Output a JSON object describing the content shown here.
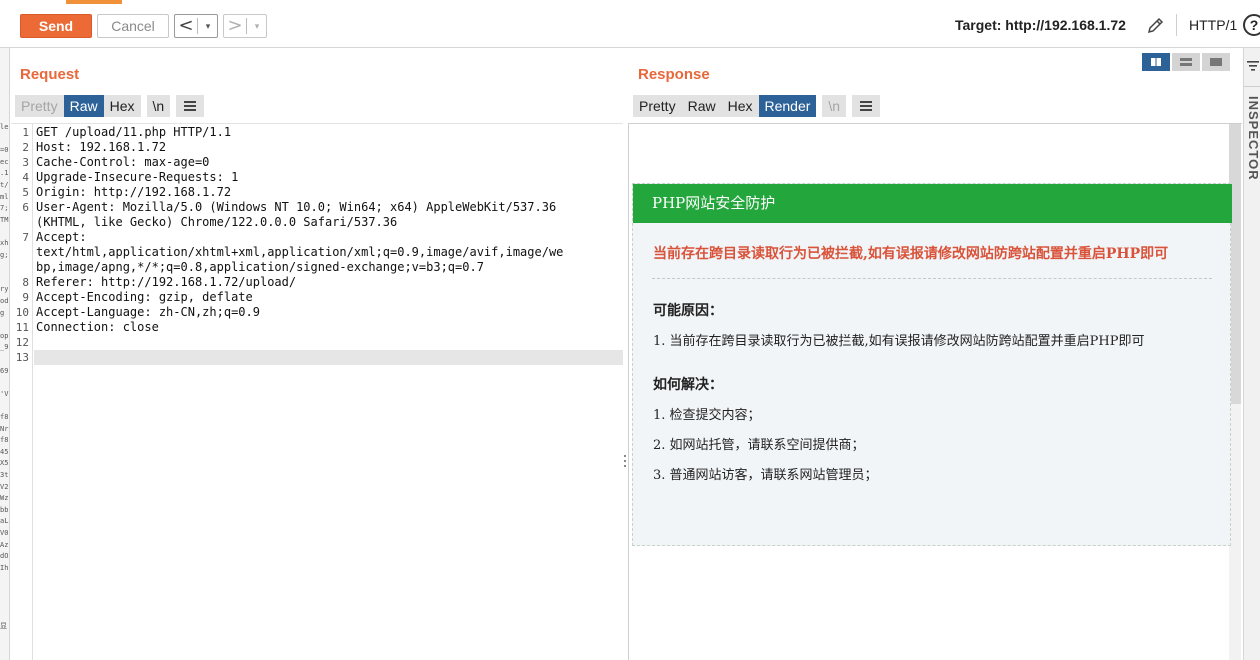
{
  "toolbar": {
    "send_label": "Send",
    "cancel_label": "Cancel",
    "back_label": "<",
    "forward_label": ">",
    "dropdown_glyph": "▾",
    "target_label": "Target: http://192.168.1.72",
    "http_version": "HTTP/1",
    "help_label": "?"
  },
  "left_strip": {
    "lines": [
      "le",
      "",
      "=0",
      "ec",
      ".1",
      "t/",
      "ml",
      "7;",
      "TM",
      "",
      "xh",
      "g;",
      "",
      "",
      "ry",
      "od",
      "g",
      "",
      "op",
      "_9",
      "",
      "69",
      "",
      "'V",
      "",
      "f8",
      "Nr",
      "f8",
      "45",
      "X5",
      "3t",
      "V2",
      "Wz",
      "bb",
      "aL",
      "V0",
      "Az",
      "dO",
      "Ih",
      "",
      "",
      "",
      "",
      "显"
    ]
  },
  "request": {
    "title": "Request",
    "tabs": [
      {
        "label": "Pretty",
        "state": "disabled"
      },
      {
        "label": "Raw",
        "state": "active"
      },
      {
        "label": "Hex",
        "state": "normal"
      },
      {
        "label": "\\n",
        "state": "normal"
      }
    ],
    "lines": [
      {
        "num": "1",
        "text": "GET /upload/11.php HTTP/1.1"
      },
      {
        "num": "2",
        "text": "Host: 192.168.1.72"
      },
      {
        "num": "3",
        "text": "Cache-Control: max-age=0"
      },
      {
        "num": "4",
        "text": "Upgrade-Insecure-Requests: 1"
      },
      {
        "num": "5",
        "text": "Origin: http://192.168.1.72"
      },
      {
        "num": "6",
        "text": "User-Agent: Mozilla/5.0 (Windows NT 10.0; Win64; x64) AppleWebKit/537.36"
      },
      {
        "num": "",
        "text": "(KHTML, like Gecko) Chrome/122.0.0.0 Safari/537.36"
      },
      {
        "num": "7",
        "text": "Accept:"
      },
      {
        "num": "",
        "text": "text/html,application/xhtml+xml,application/xml;q=0.9,image/avif,image/we"
      },
      {
        "num": "",
        "text": "bp,image/apng,*/*;q=0.8,application/signed-exchange;v=b3;q=0.7"
      },
      {
        "num": "8",
        "text": "Referer: http://192.168.1.72/upload/"
      },
      {
        "num": "9",
        "text": "Accept-Encoding: gzip, deflate"
      },
      {
        "num": "10",
        "text": "Accept-Language: zh-CN,zh;q=0.9"
      },
      {
        "num": "11",
        "text": "Connection: close"
      },
      {
        "num": "12",
        "text": ""
      },
      {
        "num": "13",
        "text": ""
      }
    ]
  },
  "response": {
    "title": "Response",
    "tabs": [
      {
        "label": "Pretty",
        "state": "normal"
      },
      {
        "label": "Raw",
        "state": "normal"
      },
      {
        "label": "Hex",
        "state": "normal"
      },
      {
        "label": "Render",
        "state": "active"
      },
      {
        "label": "\\n",
        "state": "disabled"
      }
    ],
    "render": {
      "header": "PHP网站安全防护",
      "alert": "当前存在跨目录读取行为已被拦截,如有误报请修改网站防跨站配置并重启PHP即可",
      "reasons_title": "可能原因：",
      "reasons": [
        "1. 当前存在跨目录读取行为已被拦截,如有误报请修改网站防跨站配置并重启PHP即可"
      ],
      "solutions_title": "如何解决：",
      "solutions": [
        "1. 检查提交内容；",
        "2. 如网站托管，请联系空间提供商；",
        "3. 普通网站访客，请联系网站管理员；"
      ]
    }
  },
  "inspector": {
    "label": "INSPECTOR"
  },
  "colors": {
    "accent": "#ec6a35",
    "active_tab": "#2d6298",
    "waf_green": "#23a63b",
    "alert_red": "#d9533a"
  }
}
